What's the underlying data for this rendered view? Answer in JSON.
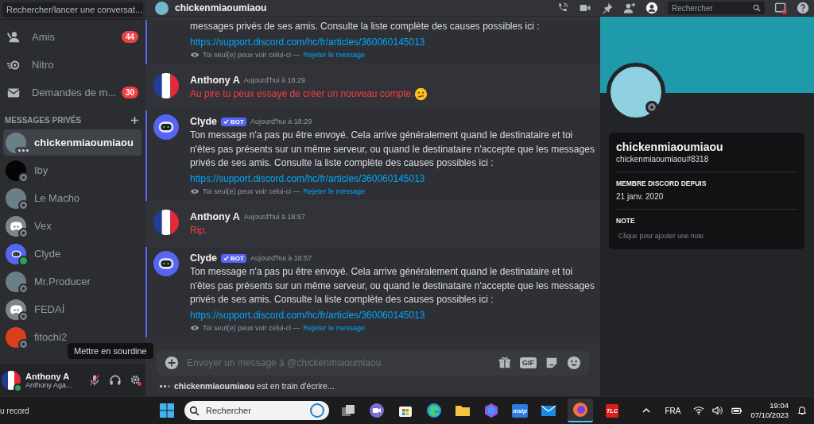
{
  "sidebar": {
    "search": {
      "placeholder": "Rechercher/lancer une conversat..."
    },
    "nav": [
      {
        "kind": "friends",
        "label": "Amis",
        "badge": "44"
      },
      {
        "kind": "nitro",
        "label": "Nitro"
      },
      {
        "kind": "requests",
        "label": "Demandes de m...",
        "badge": "30"
      }
    ],
    "section_title": "MESSAGES PRIVÉS",
    "dms": [
      {
        "name": "chickenmiaoumiaou",
        "kind": "photo",
        "typing": true,
        "selected": true
      },
      {
        "name": "Iby",
        "kind": "dark",
        "typing": false,
        "online": false,
        "selected": false
      },
      {
        "name": "Le Macho",
        "kind": "photo",
        "typing": false,
        "online": false,
        "selected": false
      },
      {
        "name": "Vex",
        "kind": "default",
        "typing": false,
        "online": false,
        "selected": false
      },
      {
        "name": "Clyde",
        "kind": "bot",
        "typing": false,
        "online": true,
        "selected": false
      },
      {
        "name": "Mr.Producer",
        "kind": "photo",
        "typing": false,
        "online": false,
        "selected": false
      },
      {
        "name": "FEDAİ",
        "kind": "default",
        "typing": false,
        "online": false,
        "selected": false
      },
      {
        "name": "fitochi2",
        "kind": "red",
        "typing": false,
        "online": false,
        "selected": false
      }
    ],
    "tooltip": "Mettre en sourdine",
    "user": {
      "name": "Anthony A",
      "subtitle": "Anthony Aga...",
      "mic_muted": true
    }
  },
  "header": {
    "title": "chickenmiaoumiaou",
    "search": {
      "placeholder": "Rechercher"
    }
  },
  "messages": [
    {
      "kind": "ephemeral",
      "continued": true,
      "text": "messages privés de ses amis. Consulte la liste complète des causes possibles ici :",
      "link": "https://support.discord.com/hc/fr/articles/360060145013",
      "note": "Toi seul(e) peux voir celui-ci —",
      "dismiss": "Rejeter le message"
    },
    {
      "kind": "user",
      "author": "Anthony A",
      "time": "Aujourd'hui à 18:29",
      "text": "Au pire tu peux essaye de créer un nouveau compte.",
      "failed": true,
      "emoji": true
    },
    {
      "kind": "ephemeral",
      "author": "Clyde",
      "bot_tag": "BOT",
      "time": "Aujourd'hui à 18:29",
      "text": "Ton message n'a pas pu être envoyé. Cela arrive généralement quand le destinataire et toi n'êtes pas présents sur un même serveur, ou quand le destinataire n'accepte que les messages privés de ses amis. Consulte la liste complète des causes possibles ici :",
      "link": "https://support.discord.com/hc/fr/articles/360060145013",
      "note": "Toi seul(e) peux voir celui-ci —",
      "dismiss": "Rejeter le message"
    },
    {
      "kind": "user",
      "author": "Anthony A",
      "time": "Aujourd'hui à 18:57",
      "text": "Rip.",
      "failed": true,
      "emoji": false
    },
    {
      "kind": "ephemeral",
      "author": "Clyde",
      "bot_tag": "BOT",
      "time": "Aujourd'hui à 18:57",
      "text": "Ton message n'a pas pu être envoyé. Cela arrive généralement quand le destinataire et toi n'êtes pas présents sur un même serveur, ou quand le destinataire n'accepte que les messages privés de ses amis. Consulte la liste complète des causes possibles ici :",
      "link": "https://support.discord.com/hc/fr/articles/360060145013",
      "note": "Toi seul(e) peux voir celui-ci —",
      "dismiss": "Rejeter le message"
    }
  ],
  "composer": {
    "placeholder": "Envoyer un message à @chickenmiaoumiaou",
    "gif": "GIF"
  },
  "typing": "**chickenmiaoumiaou** est en train d'écrire...",
  "profile": {
    "display_name": "chickenmiaoumiaou",
    "tag": "chickenmiaoumiaou#8318",
    "member_since_label": "MEMBRE DISCORD DEPUIS",
    "member_since": "21 janv. 2020",
    "note_label": "NOTE",
    "note_placeholder": "Clique pour ajouter une note"
  },
  "taskbar": {
    "left_text": "u record",
    "search": {
      "placeholder": "Rechercher"
    },
    "apps": [
      {
        "kind": "taskview"
      },
      {
        "kind": "chat"
      },
      {
        "kind": "store"
      },
      {
        "kind": "edge"
      },
      {
        "kind": "folder"
      },
      {
        "kind": "copilot"
      },
      {
        "kind": "label",
        "label": "mslp",
        "color": "#2d7be0"
      },
      {
        "kind": "mail"
      },
      {
        "kind": "firefox",
        "selected": true
      },
      {
        "kind": "label",
        "label": "TLC",
        "color": "#d81e1e"
      }
    ],
    "language": "FRA",
    "time": "19:04",
    "date": "07/10/2023"
  }
}
